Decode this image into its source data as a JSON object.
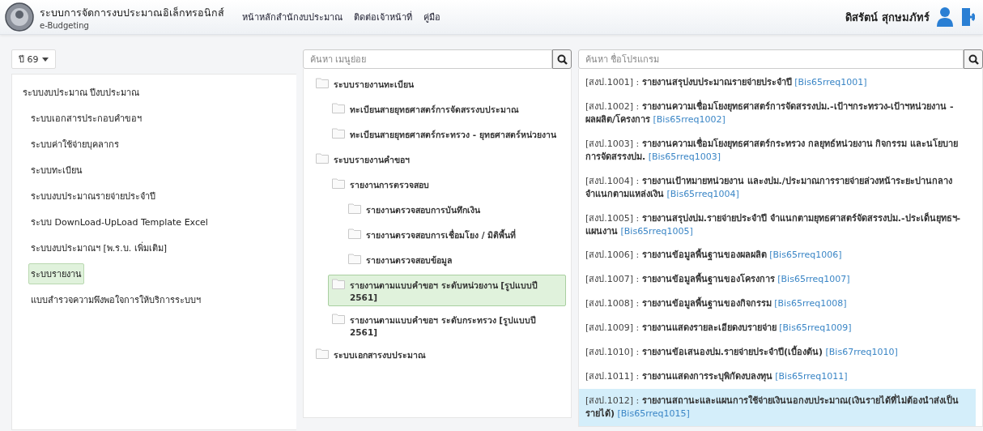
{
  "header": {
    "title": "ระบบการจัดการงบประมาณอิเล็กทรอนิกส์",
    "subtitle": "e-Budgeting",
    "nav": [
      "หน้าหลักสำนักงบประมาณ",
      "ติดต่อเจ้าหน้าที่",
      "คู่มือ"
    ],
    "user_name": "ดิสรัตน์ สุกษมภัทร์"
  },
  "year_select": {
    "value": "ปี 69"
  },
  "menu": [
    {
      "label": "ระบบงบประมาณ ปีงบประมาณ",
      "selected": false,
      "children": [
        {
          "label": "ระบบเอกสารประกอบคำขอฯ",
          "selected": false
        },
        {
          "label": "ระบบค่าใช้จ่ายบุคลากร",
          "selected": false
        },
        {
          "label": "ระบบทะเบียน",
          "selected": false
        },
        {
          "label": "ระบบงบประมาณรายจ่ายประจำปี",
          "selected": false
        },
        {
          "label": "ระบบ DownLoad-UpLoad Template Excel",
          "selected": false
        },
        {
          "label": "ระบบงบประมาณฯ [พ.ร.บ. เพิ่มเติม]",
          "selected": false
        },
        {
          "label": "ระบบรายงาน",
          "selected": true
        },
        {
          "label": "แบบสำรวจความพึงพอใจการให้บริการระบบฯ",
          "selected": false
        }
      ]
    }
  ],
  "submenu": {
    "search": {
      "placeholder": "ค้นหา เมนูย่อย"
    },
    "tree": [
      {
        "label": "ระบบรายงานทะเบียน",
        "selected": false,
        "children": [
          {
            "label": "ทะเบียนสายยุทธศาสตร์การจัดสรรงบประมาณ",
            "selected": false
          },
          {
            "label": "ทะเบียนสายยุทธศาสตร์กระทรวง - ยุทธศาสตร์หน่วยงาน",
            "selected": false
          }
        ]
      },
      {
        "label": "ระบบรายงานคำขอฯ",
        "selected": false,
        "children": [
          {
            "label": "รายงานการตรวจสอบ",
            "selected": false,
            "children": [
              {
                "label": "รายงานตรวจสอบการบันทึกเงิน",
                "selected": false
              },
              {
                "label": "รายงานตรวจสอบการเชื่อมโยง / มิติพื้นที่",
                "selected": false
              },
              {
                "label": "รายงานตรวจสอบข้อมูล",
                "selected": false
              }
            ]
          },
          {
            "label": "รายงานตามแบบคำขอฯ ระดับหน่วยงาน [รูปแบบปี 2561]",
            "selected": true
          },
          {
            "label": "รายงานตามแบบคำขอฯ ระดับกระทรวง [รูปแบบปี 2561]",
            "selected": false
          }
        ]
      },
      {
        "label": "ระบบเอกสารงบประมาณ",
        "selected": false
      }
    ]
  },
  "programs": {
    "search": {
      "placeholder": "ค้นหา ชื่อโปรแกรม"
    },
    "items": [
      {
        "code": "[สงป.1001] :",
        "title": "รายงานสรุปงบประมาณรายจ่ายประจำปี",
        "program": "[Bis65rreq1001]",
        "selected": false
      },
      {
        "code": "[สงป.1002] :",
        "title": "รายงานความเชื่อมโยงยุทธศาสตร์การจัดสรรงปม.-เป้าฯกระทรวง-เป้าฯหน่วยงาน - ผลผลิต/โครงการ",
        "program": "[Bis65rreq1002]",
        "selected": false
      },
      {
        "code": "[สงป.1003] :",
        "title": "รายงานความเชื่อมโยงยุทธศาสตร์กระทรวง กลยุทธ์หน่วยงาน กิจกรรม และนโยบายการจัดสรรงปม.",
        "program": "[Bis65rreq1003]",
        "selected": false
      },
      {
        "code": "[สงป.1004] :",
        "title": "รายงานเป้าหมายหน่วยงาน และงปม./ประมาณการรายจ่ายล่วงหน้าระยะปานกลาง จำแนกตามแหล่งเงิน",
        "program": "[Bis65rreq1004]",
        "selected": false
      },
      {
        "code": "[สงป.1005] :",
        "title": "รายงานสรุปงปม.รายจ่ายประจำปี จำแนกตามยุทธศาสตร์จัดสรรงปม.-ประเด็นยุทธฯ-แผนงาน",
        "program": "[Bis65rreq1005]",
        "selected": false
      },
      {
        "code": "[สงป.1006] :",
        "title": "รายงานข้อมูลพื้นฐานของผลผลิต",
        "program": "[Bis65rreq1006]",
        "selected": false
      },
      {
        "code": "[สงป.1007] :",
        "title": "รายงานข้อมูลพื้นฐานของโครงการ",
        "program": "[Bis65rreq1007]",
        "selected": false
      },
      {
        "code": "[สงป.1008] :",
        "title": "รายงานข้อมูลพื้นฐานของกิจกรรม",
        "program": "[Bis65rreq1008]",
        "selected": false
      },
      {
        "code": "[สงป.1009] :",
        "title": "รายงานแสดงรายละเอียดงบรายจ่าย",
        "program": "[Bis65rreq1009]",
        "selected": false
      },
      {
        "code": "[สงป.1010] :",
        "title": "รายงานข้อเสนองปม.รายจ่ายประจำปี(เบื้องต้น)",
        "program": "[Bis67rreq1010]",
        "selected": false
      },
      {
        "code": "[สงป.1011] :",
        "title": "รายงานแสดงการระบุพิกัดงบลงทุน",
        "program": "[Bis65rreq1011]",
        "selected": false
      },
      {
        "code": "[สงป.1012] :",
        "title": "รายงานสถานะและแผนการใช้จ่ายเงินนอกงบประมาณ(เงินรายได้ที่ไม่ต้องนำส่งเป็นรายได้)",
        "program": "[Bis65rreq1015]",
        "selected": true
      }
    ]
  }
}
